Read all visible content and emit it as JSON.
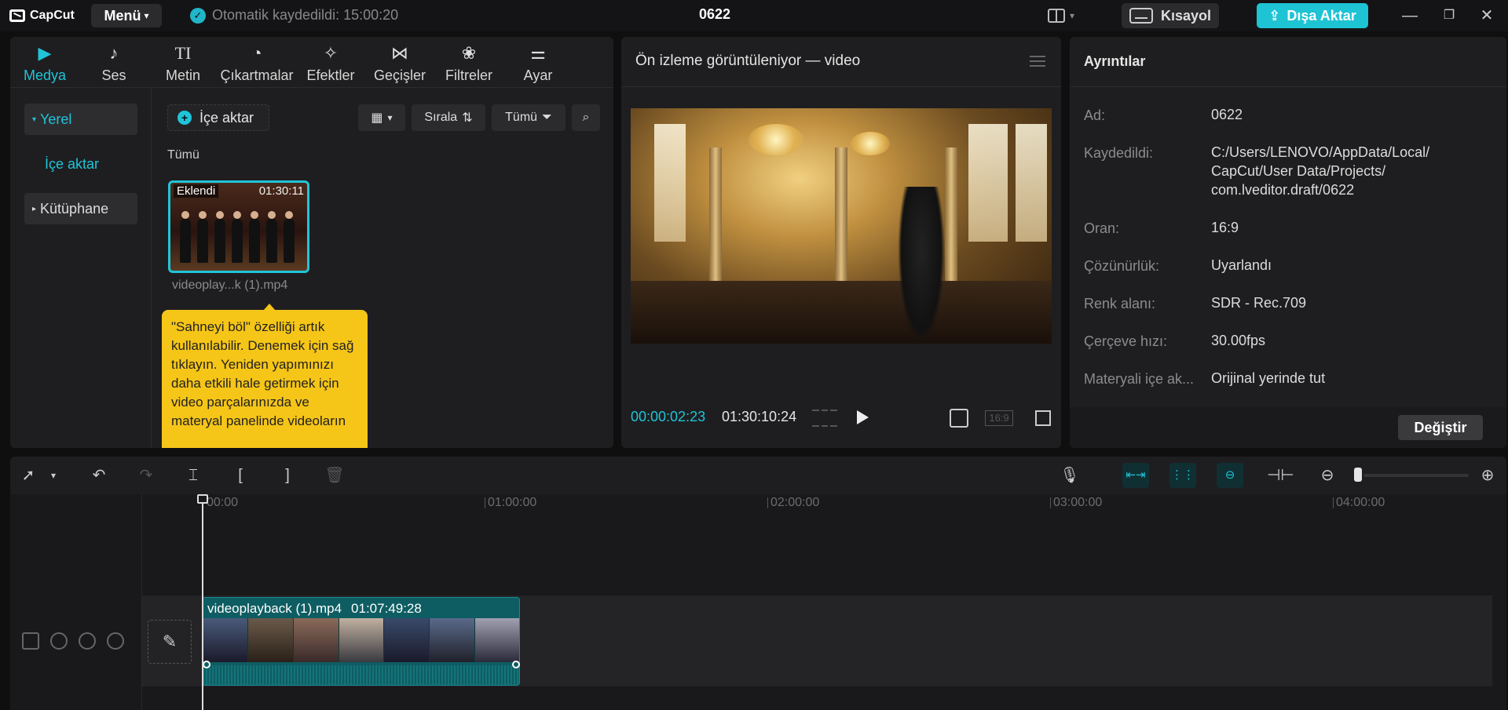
{
  "app": {
    "logo_text": "CapCut",
    "menu_label": "Menü",
    "autosave_text": "Otomatik kaydedildi: 15:00:20",
    "project_title": "0622",
    "shortcut_label": "Kısayol",
    "export_label": "Dışa Aktar",
    "accent_color": "#20c4d8"
  },
  "media_tabs": [
    {
      "label": "Medya",
      "icon": "media-icon",
      "active": true
    },
    {
      "label": "Ses",
      "icon": "audio-icon",
      "active": false
    },
    {
      "label": "Metin",
      "icon": "text-icon",
      "active": false
    },
    {
      "label": "Çıkartmalar",
      "icon": "sticker-icon",
      "active": false
    },
    {
      "label": "Efektler",
      "icon": "effects-icon",
      "active": false
    },
    {
      "label": "Geçişler",
      "icon": "transitions-icon",
      "active": false
    },
    {
      "label": "Filtreler",
      "icon": "filters-icon",
      "active": false
    },
    {
      "label": "Ayar",
      "icon": "adjust-icon",
      "active": false
    }
  ],
  "sidebar": {
    "local_label": "Yerel",
    "import_label": "İçe aktar",
    "library_label": "Kütüphane"
  },
  "media": {
    "import_button": "İçe aktar",
    "sort_label": "Sırala",
    "filter_label": "Tümü",
    "section_label": "Tümü",
    "item": {
      "badge": "Eklendi",
      "duration": "01:30:11",
      "name": "videoplay...k (1).mp4"
    },
    "tooltip": "\"Sahneyi böl\" özelliği artık kullanılabilir. Denemek için sağ tıklayın. Yeniden yapımınızı daha etkili hale getirmek için video parçalarınızda ve materyal panelinde videoların"
  },
  "preview": {
    "title": "Ön izleme görüntüleniyor — video",
    "current_time": "00:00:02:23",
    "total_time": "01:30:10:24",
    "ratio_label": "16:9"
  },
  "details": {
    "title": "Ayrıntılar",
    "rows": [
      {
        "label": "Ad:",
        "value": "0622"
      },
      {
        "label": "Kaydedildi:",
        "value": "C:/Users/LENOVO/AppData/Local/ CapCut/User Data/Projects/ com.lveditor.draft/0622"
      },
      {
        "label": "Oran:",
        "value": "16:9"
      },
      {
        "label": "Çözünürlük:",
        "value": "Uyarlandı"
      },
      {
        "label": "Renk alanı:",
        "value": "SDR - Rec.709"
      },
      {
        "label": "Çerçeve hızı:",
        "value": "30.00fps"
      },
      {
        "label": "Materyali içe ak...",
        "value": "Orijinal yerinde tut"
      }
    ],
    "change_button": "Değiştir"
  },
  "timeline": {
    "ruler_ticks": [
      "00:00",
      "01:00:00",
      "02:00:00",
      "03:00:00",
      "04:00:00"
    ],
    "clip_name": "videoplayback (1).mp4",
    "clip_duration": "01:07:49:28"
  }
}
